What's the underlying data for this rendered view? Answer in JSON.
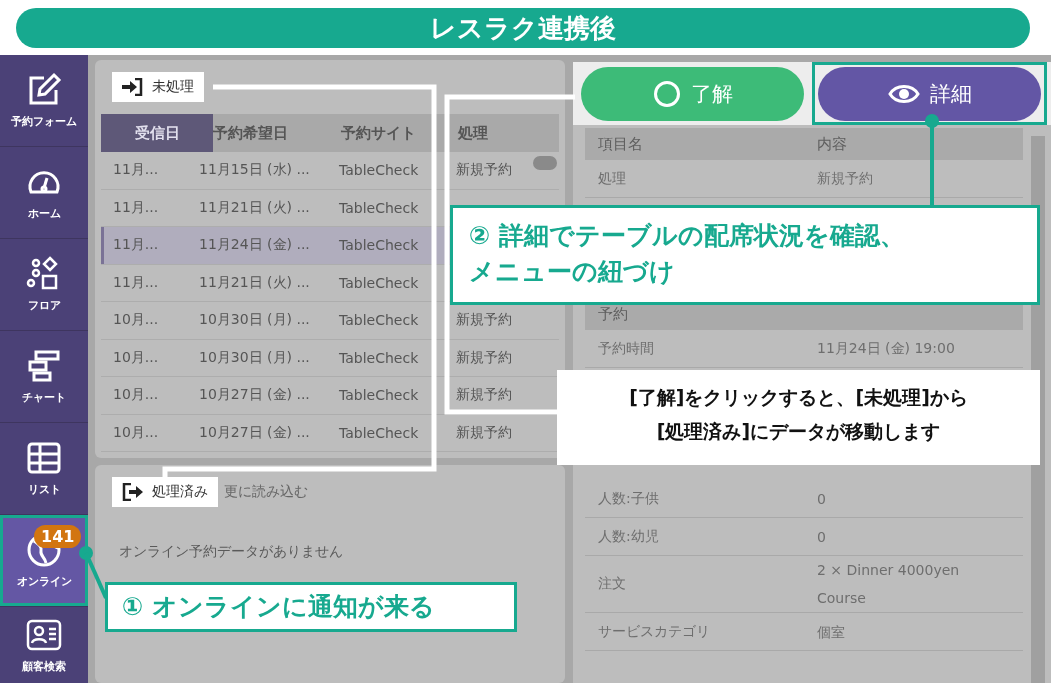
{
  "banner": {
    "title": "レスラク連携後"
  },
  "sidebar": {
    "items": [
      {
        "label": "予約フォーム",
        "kind": "form",
        "selected": false,
        "highlighted": false
      },
      {
        "label": "ホーム",
        "kind": "gauge",
        "selected": false,
        "highlighted": false
      },
      {
        "label": "フロア",
        "kind": "floor",
        "selected": false,
        "highlighted": false
      },
      {
        "label": "チャート",
        "kind": "chart",
        "selected": false,
        "highlighted": false
      },
      {
        "label": "リスト",
        "kind": "list",
        "selected": false,
        "highlighted": false
      },
      {
        "label": "オンライン",
        "kind": "globe",
        "selected": true,
        "highlighted": true,
        "badge": "141"
      },
      {
        "label": "顧客検索",
        "kind": "contact",
        "selected": false,
        "highlighted": false
      }
    ]
  },
  "pending": {
    "label": "未処理",
    "columns": [
      {
        "label": "受信日",
        "selected": true
      },
      {
        "label": "予約希望日",
        "selected": false
      },
      {
        "label": "予約サイト",
        "selected": false
      },
      {
        "label": "処理",
        "selected": false
      }
    ],
    "rows": [
      {
        "received": "11月...",
        "requested": "11月15日 (水) ...",
        "site": "TableCheck",
        "process": "新規予約",
        "selected": false
      },
      {
        "received": "11月...",
        "requested": "11月21日 (火) ...",
        "site": "TableCheck",
        "selected": false
      },
      {
        "received": "11月...",
        "requested": "11月24日 (金) ...",
        "site": "TableCheck",
        "selected": true
      },
      {
        "received": "11月...",
        "requested": "11月21日 (火) ...",
        "site": "TableCheck",
        "selected": false
      },
      {
        "received": "10月...",
        "requested": "10月30日 (月) ...",
        "site": "TableCheck",
        "process": "新規予約",
        "selected": false
      },
      {
        "received": "10月...",
        "requested": "10月30日 (月) ...",
        "site": "TableCheck",
        "process": "新規予約",
        "selected": false
      },
      {
        "received": "10月...",
        "requested": "10月27日 (金) ...",
        "site": "TableCheck",
        "process": "新規予約",
        "selected": false
      },
      {
        "received": "10月...",
        "requested": "10月27日 (金) ...",
        "site": "TableCheck",
        "process": "新規予約",
        "selected": false
      }
    ]
  },
  "done": {
    "label": "処理済み",
    "load_more": "更に読み込む",
    "empty": "オンライン予約データがありません"
  },
  "actions": [
    {
      "label": "了解",
      "kind": "accept",
      "highlighted": false
    },
    {
      "label": "詳細",
      "kind": "detail",
      "highlighted": true
    }
  ],
  "detail": {
    "columns": [
      "項目名",
      "内容"
    ],
    "top": [
      {
        "name": "処理",
        "value": "新規予約"
      }
    ],
    "section": "予約",
    "middle": [
      {
        "name": "予約時間",
        "value": "11月24日 (金) 19:00"
      }
    ],
    "bottom": [
      {
        "name": "人数:子供",
        "value": "0"
      },
      {
        "name": "人数:幼児",
        "value": "0"
      },
      {
        "name": "注文",
        "value": "2 × Dinner 4000yen Course"
      },
      {
        "name": "サービスカテゴリ",
        "value": "個室"
      }
    ]
  },
  "callouts": [
    {
      "kind": "step-detail",
      "lines": [
        "② 詳細でテーブルの配席状況を確認、",
        "メニューの紐づけ"
      ]
    },
    {
      "kind": "note",
      "lines": [
        "[了解]をクリックすると、[未処理]から",
        "[処理済み]にデータが移動します"
      ]
    },
    {
      "kind": "step-online",
      "lines": [
        "① オンラインに通知が来る"
      ]
    }
  ]
}
